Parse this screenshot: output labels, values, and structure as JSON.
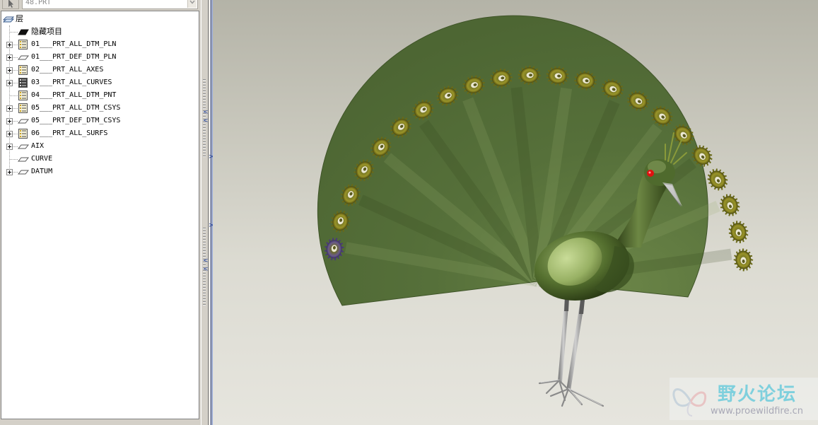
{
  "toolbar": {
    "part_name": "48.PRT"
  },
  "layer_tree": {
    "root_label": "层",
    "hidden_items_label": "隐藏项目",
    "items": [
      {
        "label": "01___PRT_ALL_DTM_PLN",
        "icon": "layer-list-icon",
        "expandable": true
      },
      {
        "label": "01___PRT_DEF_DTM_PLN",
        "icon": "layer-sheet-icon",
        "expandable": true
      },
      {
        "label": "02___PRT_ALL_AXES",
        "icon": "layer-list-icon",
        "expandable": true
      },
      {
        "label": "03___PRT_ALL_CURVES",
        "icon": "layer-list-hidden-icon",
        "expandable": true
      },
      {
        "label": "04___PRT_ALL_DTM_PNT",
        "icon": "layer-list-icon",
        "expandable": false
      },
      {
        "label": "05___PRT_ALL_DTM_CSYS",
        "icon": "layer-list-icon",
        "expandable": true
      },
      {
        "label": "05___PRT_DEF_DTM_CSYS",
        "icon": "layer-sheet-icon",
        "expandable": true
      },
      {
        "label": "06___PRT_ALL_SURFS",
        "icon": "layer-list-icon",
        "expandable": true
      },
      {
        "label": "AIX",
        "icon": "layer-sheet-icon",
        "expandable": true
      },
      {
        "label": "CURVE",
        "icon": "layer-sheet-icon",
        "expandable": false
      },
      {
        "label": "DATUM",
        "icon": "layer-sheet-icon",
        "expandable": true
      }
    ]
  },
  "watermark": {
    "title": "野火论坛",
    "url": "www.proewildfire.cn"
  },
  "colors": {
    "tail_fan": "#566f37",
    "eye_spot": "#8a8a1e",
    "eye_red": "#e01010"
  }
}
